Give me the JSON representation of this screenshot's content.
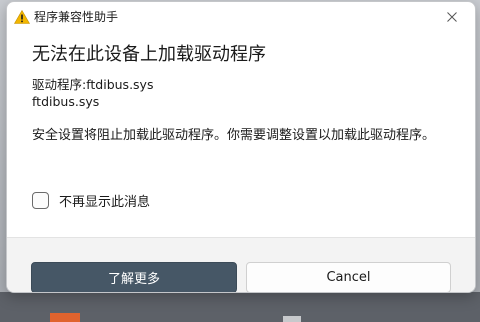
{
  "window": {
    "title": "程序兼容性助手",
    "title_icon": "warning-icon",
    "close_icon": "close-icon"
  },
  "dialog": {
    "heading": "无法在此设备上加载驱动程序",
    "driver_line": "驱动程序:ftdibus.sys",
    "driver_file": "ftdibus.sys",
    "message": "安全设置将阻止加载此驱动程序。你需要调整设置以加载此驱动程序。",
    "checkbox_label": "不再显示此消息",
    "checkbox_checked": false
  },
  "buttons": {
    "primary_label": "了解更多",
    "secondary_label": "Cancel"
  },
  "colors": {
    "primary_button": "#465766",
    "warning_yellow": "#f2b600",
    "footer_bg": "#f3f3f3"
  }
}
